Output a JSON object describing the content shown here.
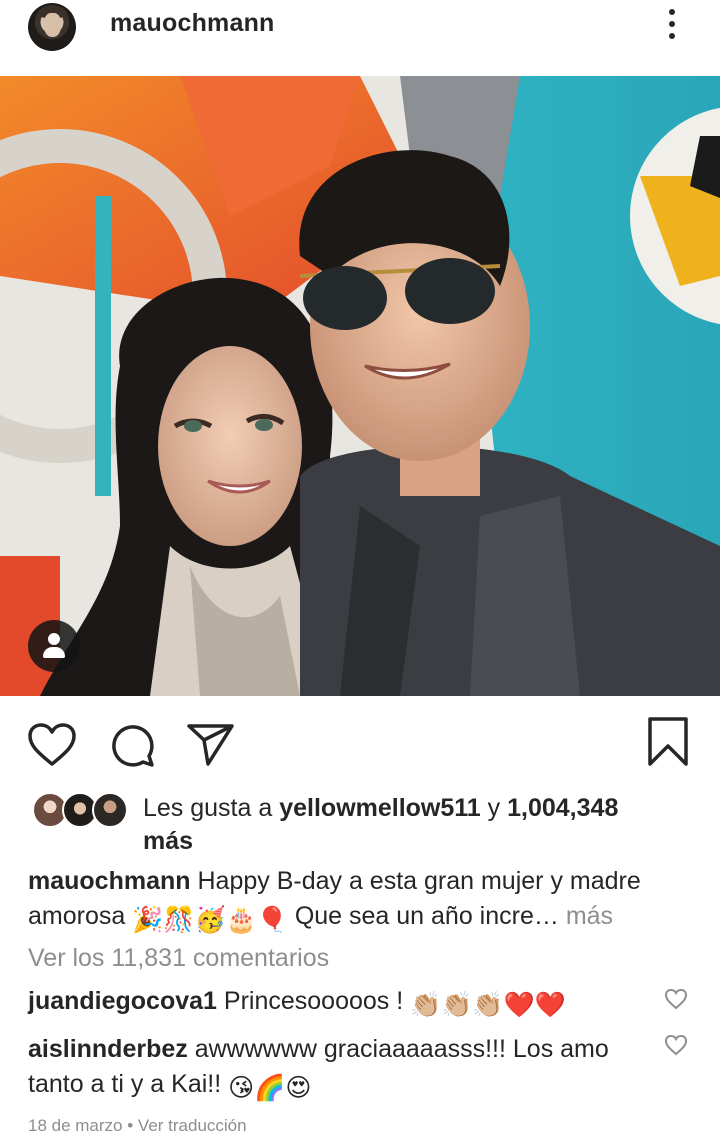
{
  "post": {
    "username": "mauochmann",
    "likes": {
      "prefix": "Les gusta a",
      "liker": "yellowmellow511",
      "connector": "y",
      "count": "1,004,348",
      "suffix": "más"
    },
    "caption": {
      "username": "mauochmann",
      "text": "Happy B-day a esta gran mujer y madre amorosa",
      "emojis": "🎉🎊🥳🎂🎈",
      "text2": "Que sea un año incre…",
      "more": "más"
    },
    "view_comments": "Ver los 11,831 comentarios",
    "comments": [
      {
        "username": "juandiegocova1",
        "text": "Princesooooos !",
        "emojis": "👏🏼👏🏼👏🏼❤️❤️"
      },
      {
        "username": "aislinnderbez",
        "text": "awwwwww graciaaaaasss!!! Los amo tanto a ti y a Kai!!",
        "emojis": "😘🌈😍"
      }
    ],
    "date": "18 de marzo",
    "translate": "Ver traducción"
  },
  "icons": {
    "more": "kebab-icon",
    "like": "heart-icon",
    "comment": "comment-icon",
    "share": "send-icon",
    "save": "bookmark-icon",
    "tag": "user-tag-icon"
  },
  "colors": {
    "text": "#262626",
    "muted": "#8e8e8e"
  }
}
